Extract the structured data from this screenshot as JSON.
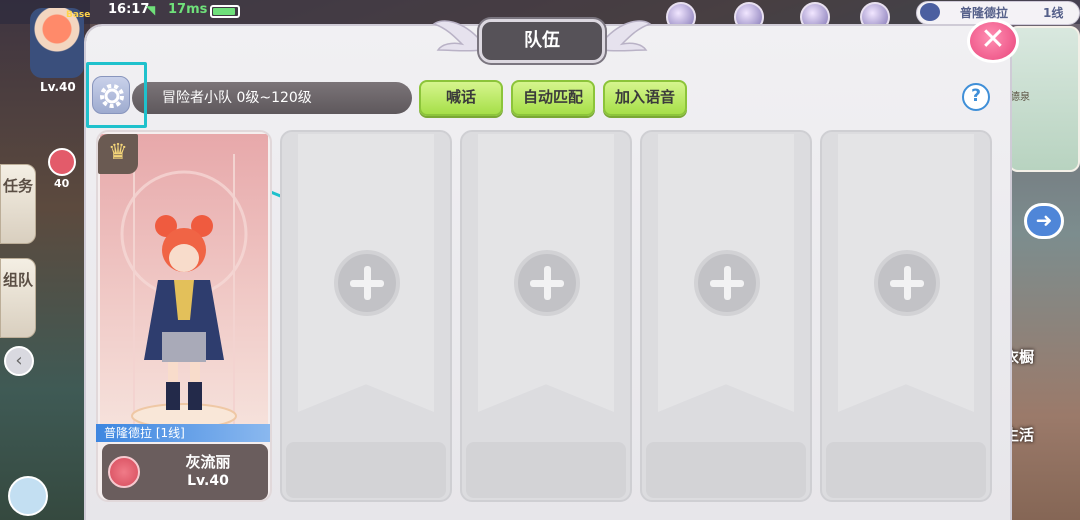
{
  "status_bar": {
    "time": "16:17",
    "ping": "17ms",
    "server_name": "普隆德拉",
    "server_line": "1线",
    "badge": "Base"
  },
  "left_hud": {
    "player_level": "Lv.40",
    "sword_level": "40",
    "quest_tab": "任务",
    "team_tab": "组队"
  },
  "right_hud": {
    "minimap_label": "德泉",
    "wardrobe_label": "衣橱",
    "life_label": "生活"
  },
  "panel": {
    "title": "队伍",
    "close_label": "✕",
    "team_name": "冒险者小队  0级~120级",
    "buttons": {
      "shout": "喊话",
      "auto_match": "自动匹配",
      "join_voice": "加入语音"
    },
    "help_label": "?"
  },
  "member": {
    "location": "普隆德拉   [1线]",
    "name": "灰流丽",
    "level": "Lv.40",
    "is_leader": true
  },
  "empty_slots": 4,
  "colors": {
    "highlight": "#1fc1cc",
    "green_button": "#a6df48",
    "close_button": "#e9457b",
    "title_bg": "#565258"
  }
}
